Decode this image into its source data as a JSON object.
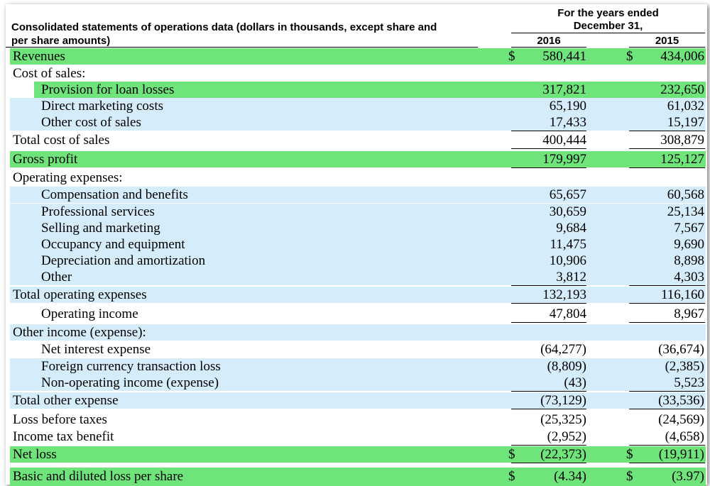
{
  "header": {
    "title_line1": "Consolidated statements of operations data (dollars in thousands, except share and",
    "title_line2": "per share amounts)",
    "period_line1": "For the years ended",
    "period_line2": "December 31,",
    "year1": "2016",
    "year2": "2015"
  },
  "rows": [
    {
      "label": "Revenues",
      "v2016": "580,441",
      "v2015": "434,006",
      "dollar": "$"
    },
    {
      "label": "Cost of sales:",
      "v2016": "",
      "v2015": ""
    },
    {
      "label": "Provision for loan losses",
      "v2016": "317,821",
      "v2015": "232,650"
    },
    {
      "label": "Direct marketing costs",
      "v2016": "65,190",
      "v2015": "61,032"
    },
    {
      "label": "Other cost of sales",
      "v2016": "17,433",
      "v2015": "15,197"
    },
    {
      "label": "Total cost of sales",
      "v2016": "400,444",
      "v2015": "308,879"
    },
    {
      "label": "Gross profit",
      "v2016": "179,997",
      "v2015": "125,127"
    },
    {
      "label": "Operating expenses:",
      "v2016": "",
      "v2015": ""
    },
    {
      "label": "Compensation and benefits",
      "v2016": "65,657",
      "v2015": "60,568"
    },
    {
      "label": "Professional services",
      "v2016": "30,659",
      "v2015": "25,134"
    },
    {
      "label": "Selling and marketing",
      "v2016": "9,684",
      "v2015": "7,567"
    },
    {
      "label": "Occupancy and equipment",
      "v2016": "11,475",
      "v2015": "9,690"
    },
    {
      "label": "Depreciation and amortization",
      "v2016": "10,906",
      "v2015": "8,898"
    },
    {
      "label": "Other",
      "v2016": "3,812",
      "v2015": "4,303"
    },
    {
      "label": "Total operating expenses",
      "v2016": "132,193",
      "v2015": "116,160"
    },
    {
      "label": "Operating income",
      "v2016": "47,804",
      "v2015": "8,967"
    },
    {
      "label": "Other income (expense):",
      "v2016": "",
      "v2015": ""
    },
    {
      "label": "Net interest expense",
      "v2016": "(64,277)",
      "v2015": "(36,674)"
    },
    {
      "label": "Foreign currency transaction loss",
      "v2016": "(8,809)",
      "v2015": "(2,385)"
    },
    {
      "label": "Non-operating income (expense)",
      "v2016": "(43)",
      "v2015": "5,523"
    },
    {
      "label": "Total other expense",
      "v2016": "(73,129)",
      "v2015": "(33,536)"
    },
    {
      "label": "Loss before taxes",
      "v2016": "(25,325)",
      "v2015": "(24,569)"
    },
    {
      "label": "Income tax benefit",
      "v2016": "(2,952)",
      "v2015": "(4,658)"
    },
    {
      "label": "Net loss",
      "v2016": "(22,373)",
      "v2015": "(19,911)",
      "dollar": "$"
    },
    {
      "label": "Basic and diluted loss per share",
      "v2016": "(4.34)",
      "v2015": "(3.97)",
      "dollar": "$"
    }
  ],
  "colors": {
    "highlight_green": "#6fe47a",
    "highlight_blue": "#d5ecfa"
  }
}
